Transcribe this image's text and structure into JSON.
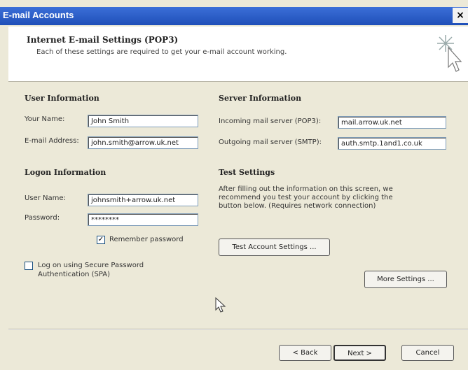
{
  "window": {
    "title": "E-mail Accounts",
    "close_glyph": "×"
  },
  "header": {
    "title": "Internet E-mail Settings (POP3)",
    "subtitle": "Each of these settings are required to get your e-mail account working.",
    "icon": "wizard-sparkle-cursor-icon"
  },
  "user_info": {
    "heading": "User Information",
    "name_label": "Your Name:",
    "name_value": "John Smith",
    "email_label": "E-mail Address:",
    "email_value": "john.smith@arrow.uk.net"
  },
  "logon_info": {
    "heading": "Logon Information",
    "user_label": "User Name:",
    "user_value": "johnsmith+arrow.uk.net",
    "password_label": "Password:",
    "password_value": "********",
    "remember_label": "Remember password",
    "remember_checked": true,
    "spa_label_line1": "Log on using Secure Password",
    "spa_label_line2": "Authentication (SPA)",
    "spa_checked": false
  },
  "server_info": {
    "heading": "Server Information",
    "incoming_label": "Incoming mail server (POP3):",
    "incoming_value": "mail.arrow.uk.net",
    "outgoing_label": "Outgoing mail server (SMTP):",
    "outgoing_value": "auth.smtp.1and1.co.uk"
  },
  "test_settings": {
    "heading": "Test Settings",
    "description": "After filling out the information on this screen, we recommend you test your account by clicking the button below. (Requires network connection)",
    "test_button": "Test Account Settings ..."
  },
  "buttons": {
    "more_settings": "More Settings ...",
    "back": "< Back",
    "next": "Next >",
    "cancel": "Cancel"
  },
  "colors": {
    "titlebar": "#2a5bc4",
    "dialog_bg": "#ece9d8",
    "input_border": "#7f9db9"
  }
}
